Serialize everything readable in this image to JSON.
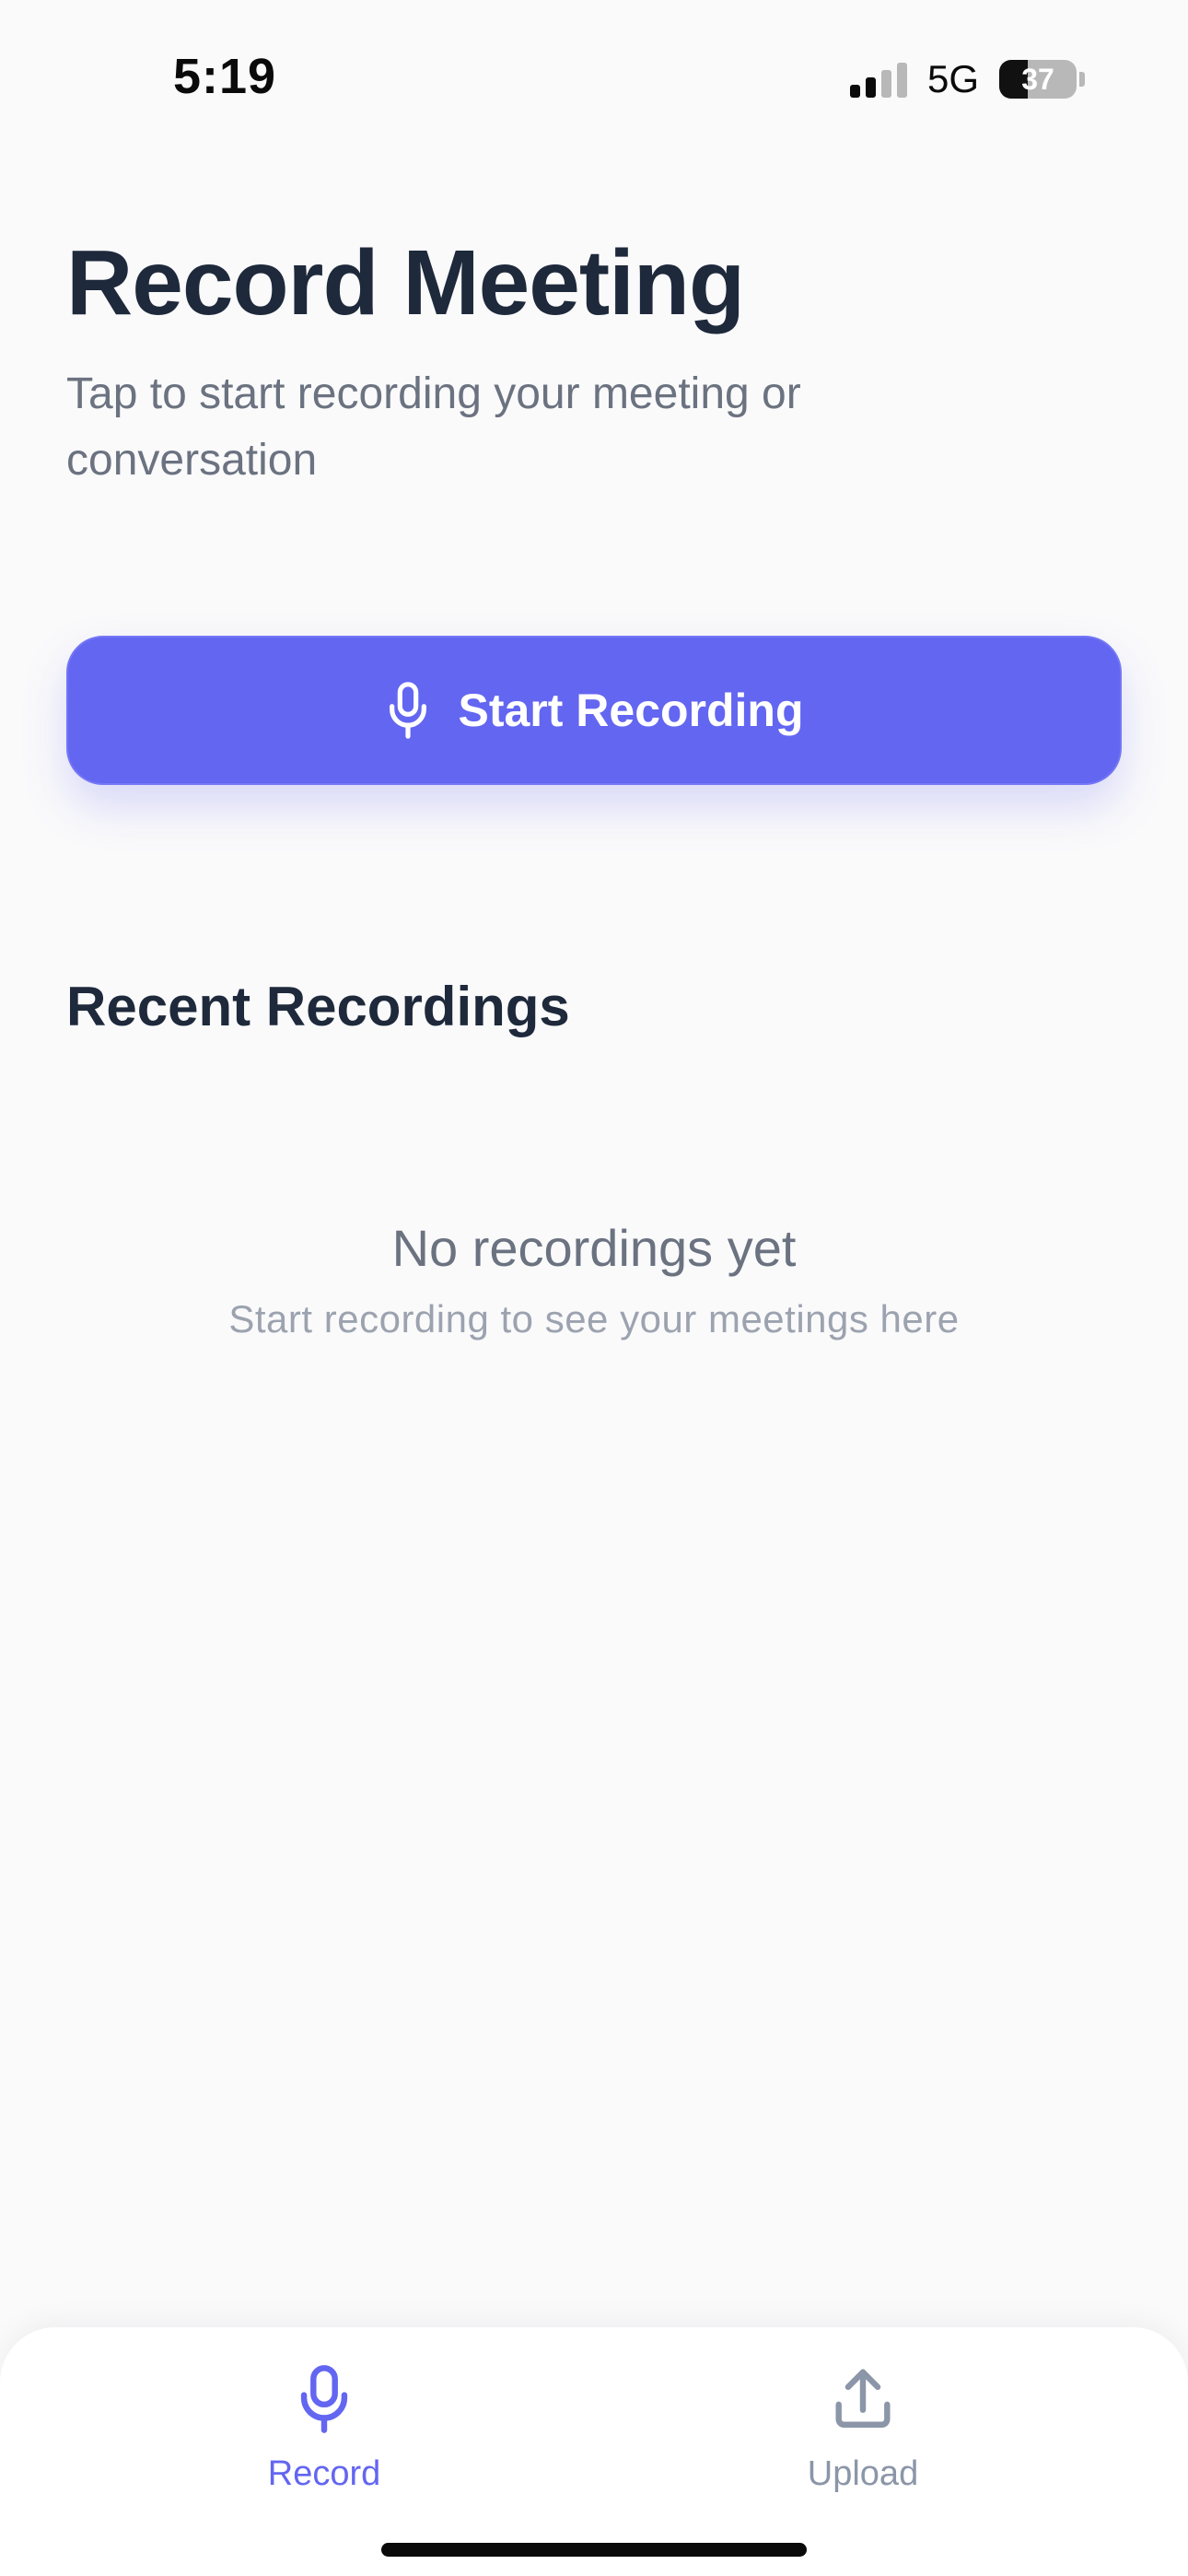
{
  "status_bar": {
    "time": "5:19",
    "network": "5G",
    "battery_level": "37",
    "battery_fraction": 0.37,
    "signal_bars_active": 2,
    "signal_bars_total": 4
  },
  "header": {
    "title": "Record Meeting",
    "subtitle": "Tap to start recording your meeting or conversation"
  },
  "start_button": {
    "label": "Start Recording",
    "icon": "microphone-icon"
  },
  "recent": {
    "title": "Recent Recordings",
    "empty_title": "No recordings yet",
    "empty_subtitle": "Start recording to see your meetings here"
  },
  "tabs": [
    {
      "label": "Record",
      "icon": "microphone-icon",
      "active": true
    },
    {
      "label": "Upload",
      "icon": "upload-icon",
      "active": false
    }
  ],
  "colors": {
    "accent": "#6366f1",
    "title_text": "#1e293b",
    "muted_text": "#6b7280",
    "faint_text": "#9ca3af",
    "inactive_tab": "#8b96a8",
    "background": "#fafafb"
  }
}
